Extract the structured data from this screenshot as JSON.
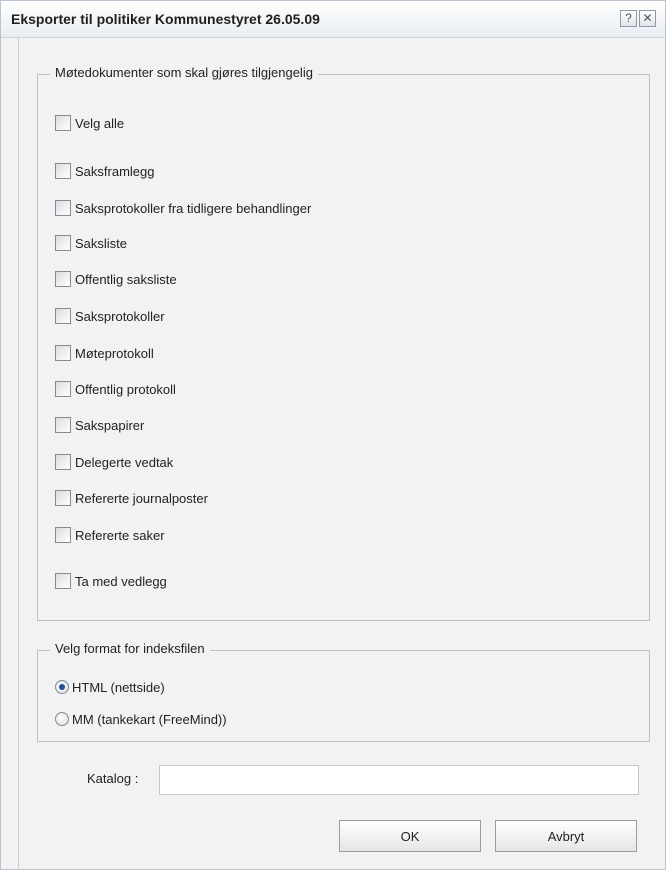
{
  "window": {
    "title": "Eksporter til politiker Kommunestyret 26.05.09",
    "help_glyph": "?",
    "close_glyph": "✕"
  },
  "documents_group": {
    "legend": "Møtedokumenter som skal gjøres tilgjengelig",
    "select_all": {
      "label": "Velg alle",
      "checked": false
    },
    "items": [
      {
        "label": "Saksframlegg",
        "checked": false
      },
      {
        "label": "Saksprotokoller fra tidligere behandlinger",
        "checked": false
      },
      {
        "label": "Saksliste",
        "checked": false
      },
      {
        "label": "Offentlig saksliste",
        "checked": false
      },
      {
        "label": "Saksprotokoller",
        "checked": false
      },
      {
        "label": "Møteprotokoll",
        "checked": false
      },
      {
        "label": "Offentlig protokoll",
        "checked": false
      },
      {
        "label": "Sakspapirer",
        "checked": false
      },
      {
        "label": "Delegerte vedtak",
        "checked": false
      },
      {
        "label": "Refererte journalposter",
        "checked": false
      },
      {
        "label": "Refererte saker",
        "checked": false
      }
    ],
    "include_attachments": {
      "label": "Ta med vedlegg",
      "checked": false
    }
  },
  "format_group": {
    "legend": "Velg format for indeksfilen",
    "options": [
      {
        "label": "HTML (nettside)",
        "selected": true
      },
      {
        "label": "MM (tankekart (FreeMind))",
        "selected": false
      }
    ]
  },
  "katalog": {
    "label": "Katalog :",
    "value": ""
  },
  "buttons": {
    "ok": "OK",
    "cancel": "Avbryt"
  },
  "colors": {
    "dialog_background": "#f2f2f2",
    "radio_selected": "#1d4f9c"
  }
}
